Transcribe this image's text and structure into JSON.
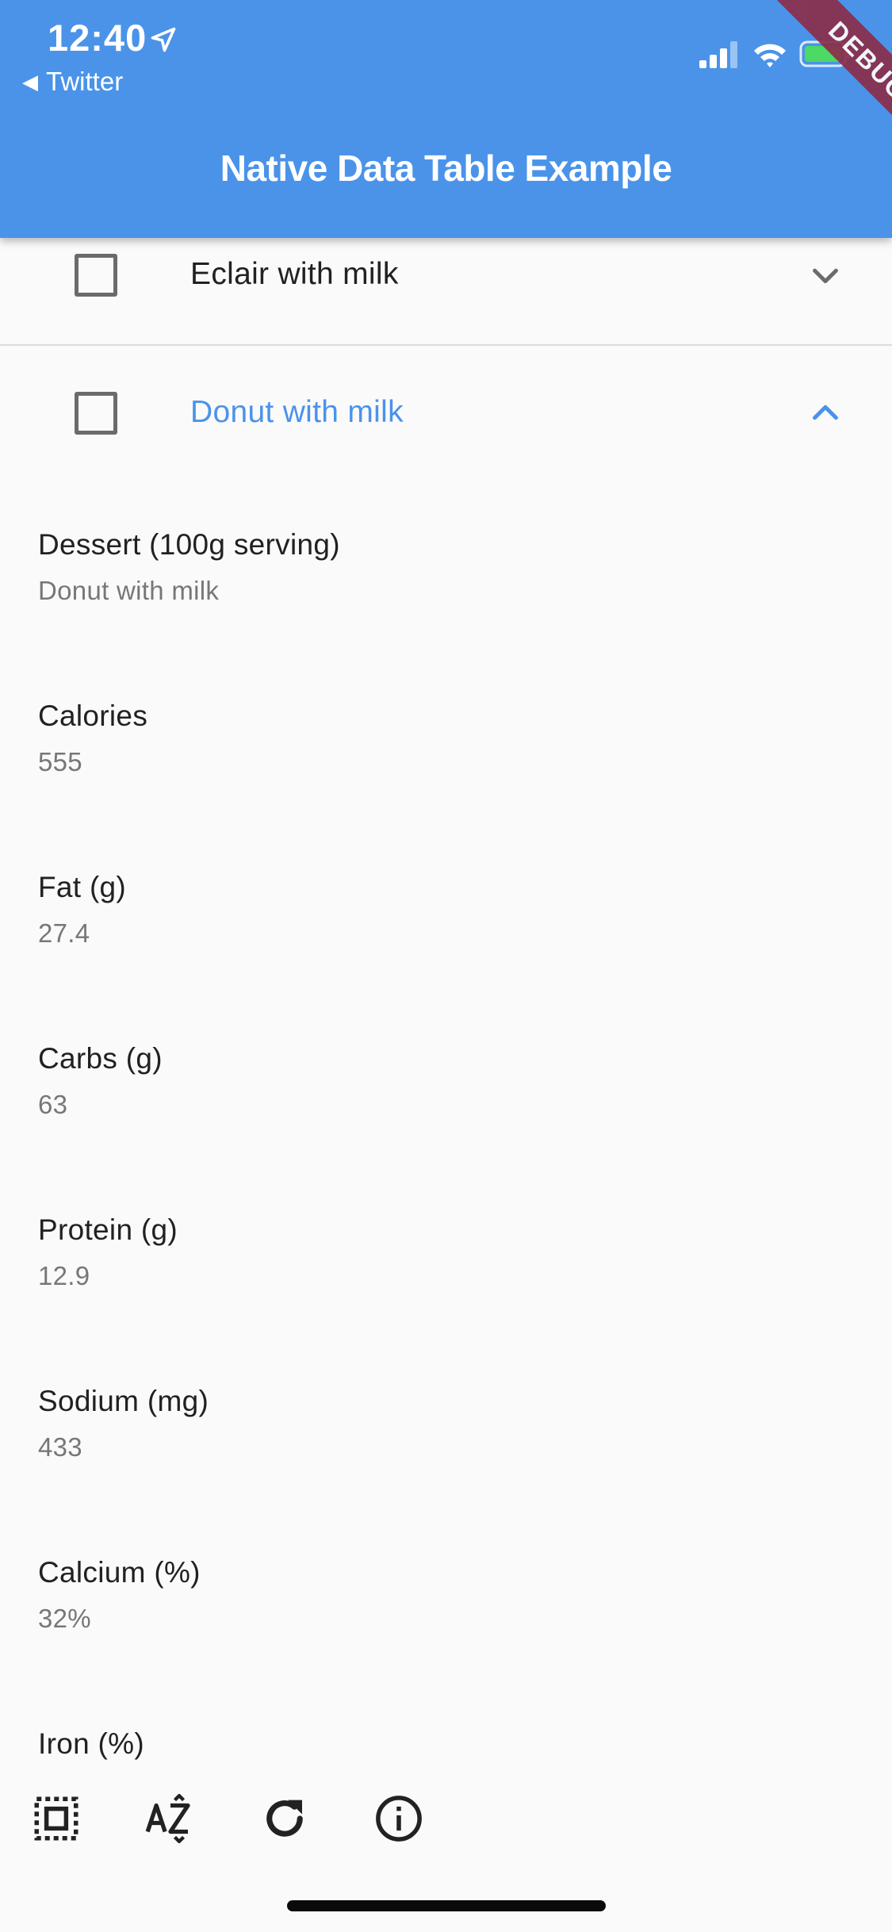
{
  "status_bar": {
    "time": "12:40",
    "back_app": "Twitter",
    "icons": [
      "location-arrow-icon",
      "cellular-signal-icon",
      "wifi-icon",
      "battery-charging-icon"
    ]
  },
  "app_bar": {
    "title": "Native Data Table Example",
    "color": "#4a93e9",
    "debug_banner": "DEBUG"
  },
  "rows": [
    {
      "label": "Eclair with milk",
      "checked": false,
      "expanded": false
    },
    {
      "label": "Donut with milk",
      "checked": false,
      "expanded": true
    }
  ],
  "details": [
    {
      "label": "Dessert (100g serving)",
      "value": "Donut with milk"
    },
    {
      "label": "Calories",
      "value": "555"
    },
    {
      "label": "Fat (g)",
      "value": "27.4"
    },
    {
      "label": "Carbs (g)",
      "value": "63"
    },
    {
      "label": "Protein (g)",
      "value": "12.9"
    },
    {
      "label": "Sodium (mg)",
      "value": "433"
    },
    {
      "label": "Calcium (%)",
      "value": "32%"
    },
    {
      "label": "Iron (%)",
      "value": ""
    }
  ],
  "bottom_bar": {
    "buttons": [
      "select-all-icon",
      "sort-az-icon",
      "refresh-icon",
      "info-icon"
    ]
  },
  "colors": {
    "accent": "#4a93e9",
    "debug": "#8b2e4a",
    "text_primary": "#212121",
    "text_secondary": "#777777"
  }
}
